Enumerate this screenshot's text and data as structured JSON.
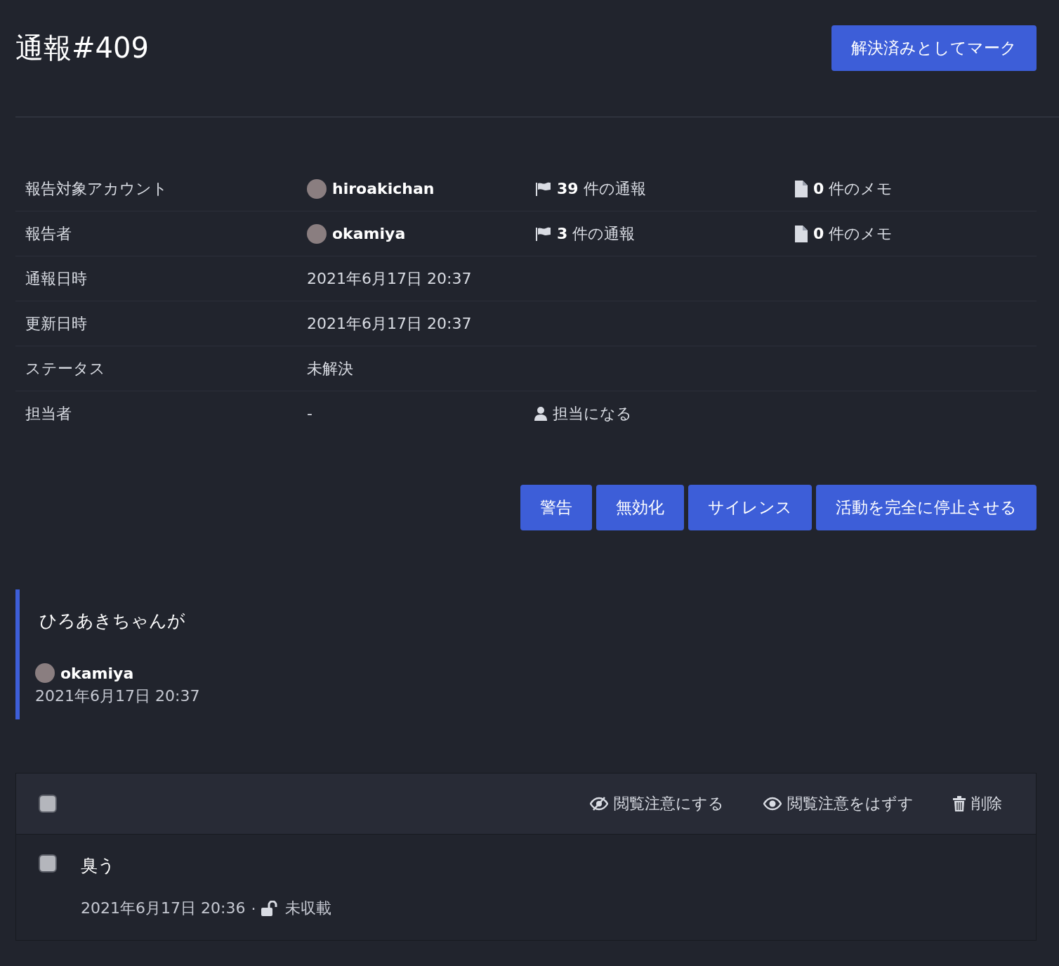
{
  "title": "通報#409",
  "resolve_button": "解決済みとしてマーク",
  "info_rows": [
    {
      "kind": "account",
      "label": "報告対象アカウント",
      "user": "hiroakichan",
      "reports": "**39** 件の通報",
      "memos": "**0** 件のメモ"
    },
    {
      "kind": "account",
      "label": "報告者",
      "user": "okamiya",
      "reports": "**3** 件の通報",
      "memos": "**0** 件のメモ"
    },
    {
      "kind": "text",
      "label": "通報日時",
      "value": "2021年6月17日 20:37"
    },
    {
      "kind": "text",
      "label": "更新日時",
      "value": "2021年6月17日 20:37"
    },
    {
      "kind": "text",
      "label": "ステータス",
      "value": "未解決"
    },
    {
      "kind": "assignee",
      "label": "担当者",
      "value": "-",
      "action": "担当になる"
    }
  ],
  "action_buttons": [
    "警告",
    "無効化",
    "サイレンス",
    "活動を完全に停止させる"
  ],
  "comment": {
    "text": "ひろあきちゃんが",
    "author": "okamiya",
    "time": "2021年6月17日 20:37"
  },
  "statuses": {
    "select_all_checked": false,
    "actions": [
      {
        "kind": "sensitive",
        "label": "閲覧注意にする"
      },
      {
        "kind": "unsensitive",
        "label": "閲覧注意をはずす"
      },
      {
        "kind": "delete",
        "label": "削除"
      }
    ],
    "items": [
      {
        "text": "臭う",
        "checked": false,
        "time": "2021年6月17日 20:36",
        "separator": "·",
        "visibility": "未収載"
      }
    ]
  }
}
